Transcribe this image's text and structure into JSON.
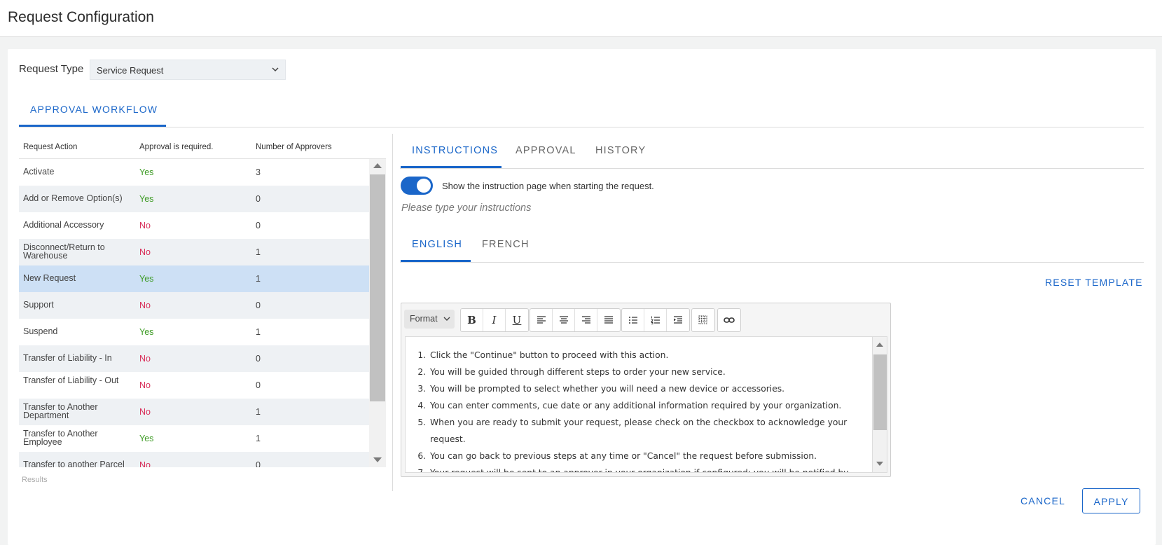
{
  "page": {
    "title": "Request Configuration"
  },
  "request_type": {
    "label": "Request Type",
    "value": "Service Request"
  },
  "main_tab": {
    "label": "APPROVAL WORKFLOW"
  },
  "table": {
    "headers": [
      "Request Action",
      "Approval is required.",
      "Number of Approvers"
    ],
    "rows": [
      {
        "action": "Activate",
        "required": "Yes",
        "approvers": "3"
      },
      {
        "action": "Add or Remove Option(s)",
        "required": "Yes",
        "approvers": "0"
      },
      {
        "action": "Additional Accessory",
        "required": "No",
        "approvers": "0"
      },
      {
        "action": "Disconnect/Return to Warehouse",
        "required": "No",
        "approvers": "1"
      },
      {
        "action": "New Request",
        "required": "Yes",
        "approvers": "1"
      },
      {
        "action": "Support",
        "required": "No",
        "approvers": "0"
      },
      {
        "action": "Suspend",
        "required": "Yes",
        "approvers": "1"
      },
      {
        "action": "Transfer of Liability - In",
        "required": "No",
        "approvers": "0"
      },
      {
        "action": "Transfer of Liability - Out",
        "required": "No",
        "approvers": "0"
      },
      {
        "action": "Transfer to Another Department",
        "required": "No",
        "approvers": "1"
      },
      {
        "action": "Transfer to Another Employee",
        "required": "Yes",
        "approvers": "1"
      },
      {
        "action": "Transfer to another Parcel",
        "required": "No",
        "approvers": "0"
      }
    ],
    "selected_index": 4,
    "results_label": "Results"
  },
  "right_tabs": [
    "INSTRUCTIONS",
    "APPROVAL",
    "HISTORY"
  ],
  "instructions": {
    "toggle_label": "Show the instruction page when starting the request.",
    "toggle_on": true,
    "placeholder": "Please type your instructions"
  },
  "language_tabs": [
    "ENGLISH",
    "FRENCH"
  ],
  "reset_label": "RESET TEMPLATE",
  "editor": {
    "format_label": "Format",
    "items": [
      "Click the \"Continue\" button to proceed with this action.",
      "You will be guided through different steps to order your new service.",
      "You will be prompted to select whether you will need a new device or accessories.",
      "You can enter comments, cue date or any additional information required by your organization.",
      "When you are ready to submit your request, please check on the checkbox to acknowledge your request.",
      "You can go back to previous steps at any time or \"Cancel\" the request before submission.",
      "Your request will be sent to an approver in your organization if configured; you will be notified by email"
    ]
  },
  "footer": {
    "cancel_label": "CANCEL",
    "apply_label": "APPLY"
  },
  "colors": {
    "accent": "#1a66c9",
    "yes": "#3c9a23",
    "no": "#d9305a",
    "selected_row": "#cde0f5"
  }
}
